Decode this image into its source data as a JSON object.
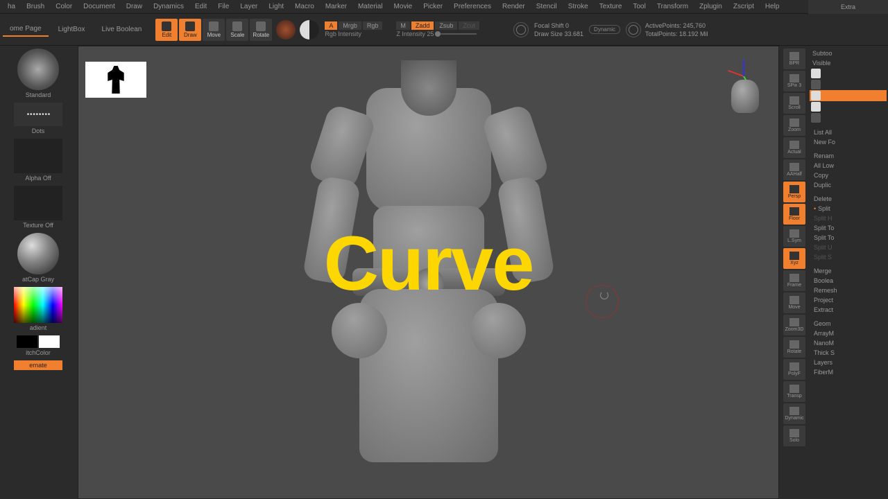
{
  "menu": [
    "ha",
    "Brush",
    "Color",
    "Document",
    "Draw",
    "Dynamics",
    "Edit",
    "File",
    "Layer",
    "Light",
    "Macro",
    "Marker",
    "Material",
    "Movie",
    "Picker",
    "Preferences",
    "Render",
    "Stencil",
    "Stroke",
    "Texture",
    "Tool",
    "Transform",
    "Zplugin",
    "Zscript",
    "Help"
  ],
  "toolbar": {
    "homePage": "ome Page",
    "lightBox": "LightBox",
    "liveBoolean": "Live Boolean",
    "edit": "Edit",
    "draw": "Draw",
    "move": "Move",
    "scale": "Scale",
    "rotate": "Rotate",
    "a": "A",
    "mrgb": "Mrgb",
    "rgb": "Rgb",
    "m": "M",
    "zadd": "Zadd",
    "zsub": "Zsub",
    "zcut": "Zcut",
    "rgbIntensity": "Rgb Intensity",
    "zIntensity": "Z Intensity 25",
    "focalShift": "Focal Shift 0",
    "drawSize": "Draw Size 33.681",
    "dynamic": "Dynamic",
    "activePoints": "ActivePoints: 245,760",
    "totalPoints": "TotalPoints: 18.192 Mil"
  },
  "left": {
    "standard": "Standard",
    "dots": "Dots",
    "alphaOff": "Alpha Off",
    "textureOff": "Texture Off",
    "matcap": "atCap Gray",
    "gradient": "adient",
    "switchColor": "itchColor",
    "alternate": "ernate"
  },
  "overlay": "Curve",
  "rail": [
    "BPR",
    "SPix 3",
    "Scroll",
    "Zoom",
    "Actual",
    "AAHalf",
    "Persp",
    "Floor",
    "L.Sym",
    "Xyz",
    "Frame",
    "Move",
    "Zoom3D",
    "Rotate",
    "PolyF",
    "Transp",
    "Dynamic",
    "Solo"
  ],
  "railActive": [
    false,
    false,
    false,
    false,
    false,
    false,
    true,
    true,
    false,
    true,
    false,
    false,
    false,
    false,
    false,
    false,
    false,
    false
  ],
  "right": {
    "extra": "Extra",
    "subtool": "Subtoo",
    "visible": "Visible",
    "listAll": "List All",
    "newFolder": "New Fo",
    "rename": "Renam",
    "allLow": "All Low",
    "copy": "Copy",
    "duplicate": "Duplic",
    "delete": "Delete",
    "split": "Split",
    "splitH": "Split H",
    "splitTo1": "Split To",
    "splitTo2": "Split To",
    "splitU": "Split U",
    "splitS": "Split S",
    "merge": "Merge",
    "boolean": "Boolea",
    "remesh": "Remesh",
    "project": "Project",
    "extract": "Extract",
    "geometry": "Geom",
    "arrayMesh": "ArrayM",
    "nanoMesh": "NanoM",
    "thickSkin": "Thick S",
    "layers": "Layers",
    "fiberMesh": "FiberM"
  }
}
